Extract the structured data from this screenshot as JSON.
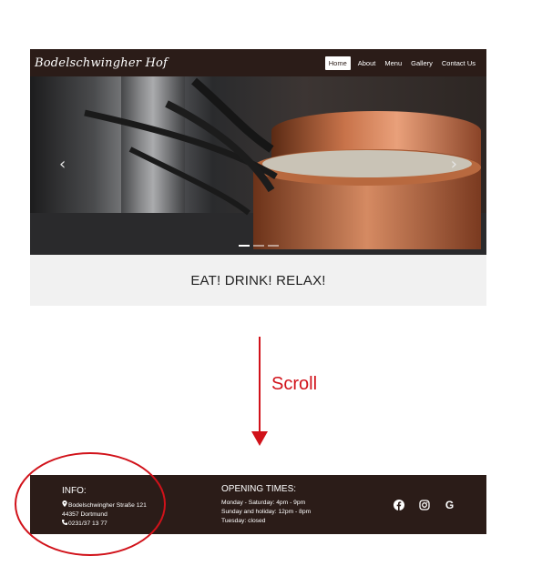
{
  "site": {
    "brand": "Bodelschwingher Hof",
    "nav": [
      "Home",
      "About",
      "Menu",
      "Gallery",
      "Contact Us"
    ],
    "active_nav": "Home",
    "tagline": "EAT! DRINK! RELAX!"
  },
  "annotation": {
    "scroll_label": "Scroll",
    "color": "#d1121a"
  },
  "footer": {
    "info_heading": "INFO:",
    "address_line1": "Bodelschwingher Straße 121",
    "address_line2": "44357 Dortmund",
    "phone": "0231/37 13 77",
    "hours_heading": "OPENING TIMES:",
    "hours": [
      "Monday - Saturday: 4pm - 9pm",
      "Sunday and holiday: 12pm - 8pm",
      "Tuesday: closed"
    ],
    "socials": [
      "facebook-icon",
      "instagram-icon",
      "google-icon"
    ],
    "background": "#2b1c18"
  }
}
